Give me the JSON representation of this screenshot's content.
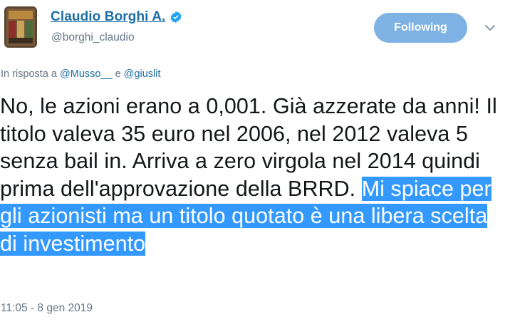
{
  "tweet": {
    "author": {
      "display_name": "Claudio Borghi A.",
      "handle": "@borghi_claudio",
      "verified": true,
      "verified_icon": "verified-badge-icon"
    },
    "follow_button_label": "Following",
    "reply": {
      "prefix": "In risposta a",
      "user1": "@Musso__",
      "conjunction": "e",
      "user2": "@giuslit"
    },
    "text_plain": "No, le azioni erano a 0,001. Già azzerate da anni! Il titolo valeva 35 euro nel 2006, nel 2012 valeva 5 senza bail in. Arriva a zero virgola nel 2014 quindi prima dell'approvazione della BRRD. ",
    "text_highlighted": "Mi spiace per gli azionisti ma un titolo quotato è una libera scelta di investimento",
    "timestamp": "11:05 - 8 gen 2019"
  },
  "colors": {
    "link_blue": "#1d6fa5",
    "follow_button_bg": "#7fb2e4",
    "selection_highlight": "#3399ff",
    "secondary_text": "#657786"
  }
}
